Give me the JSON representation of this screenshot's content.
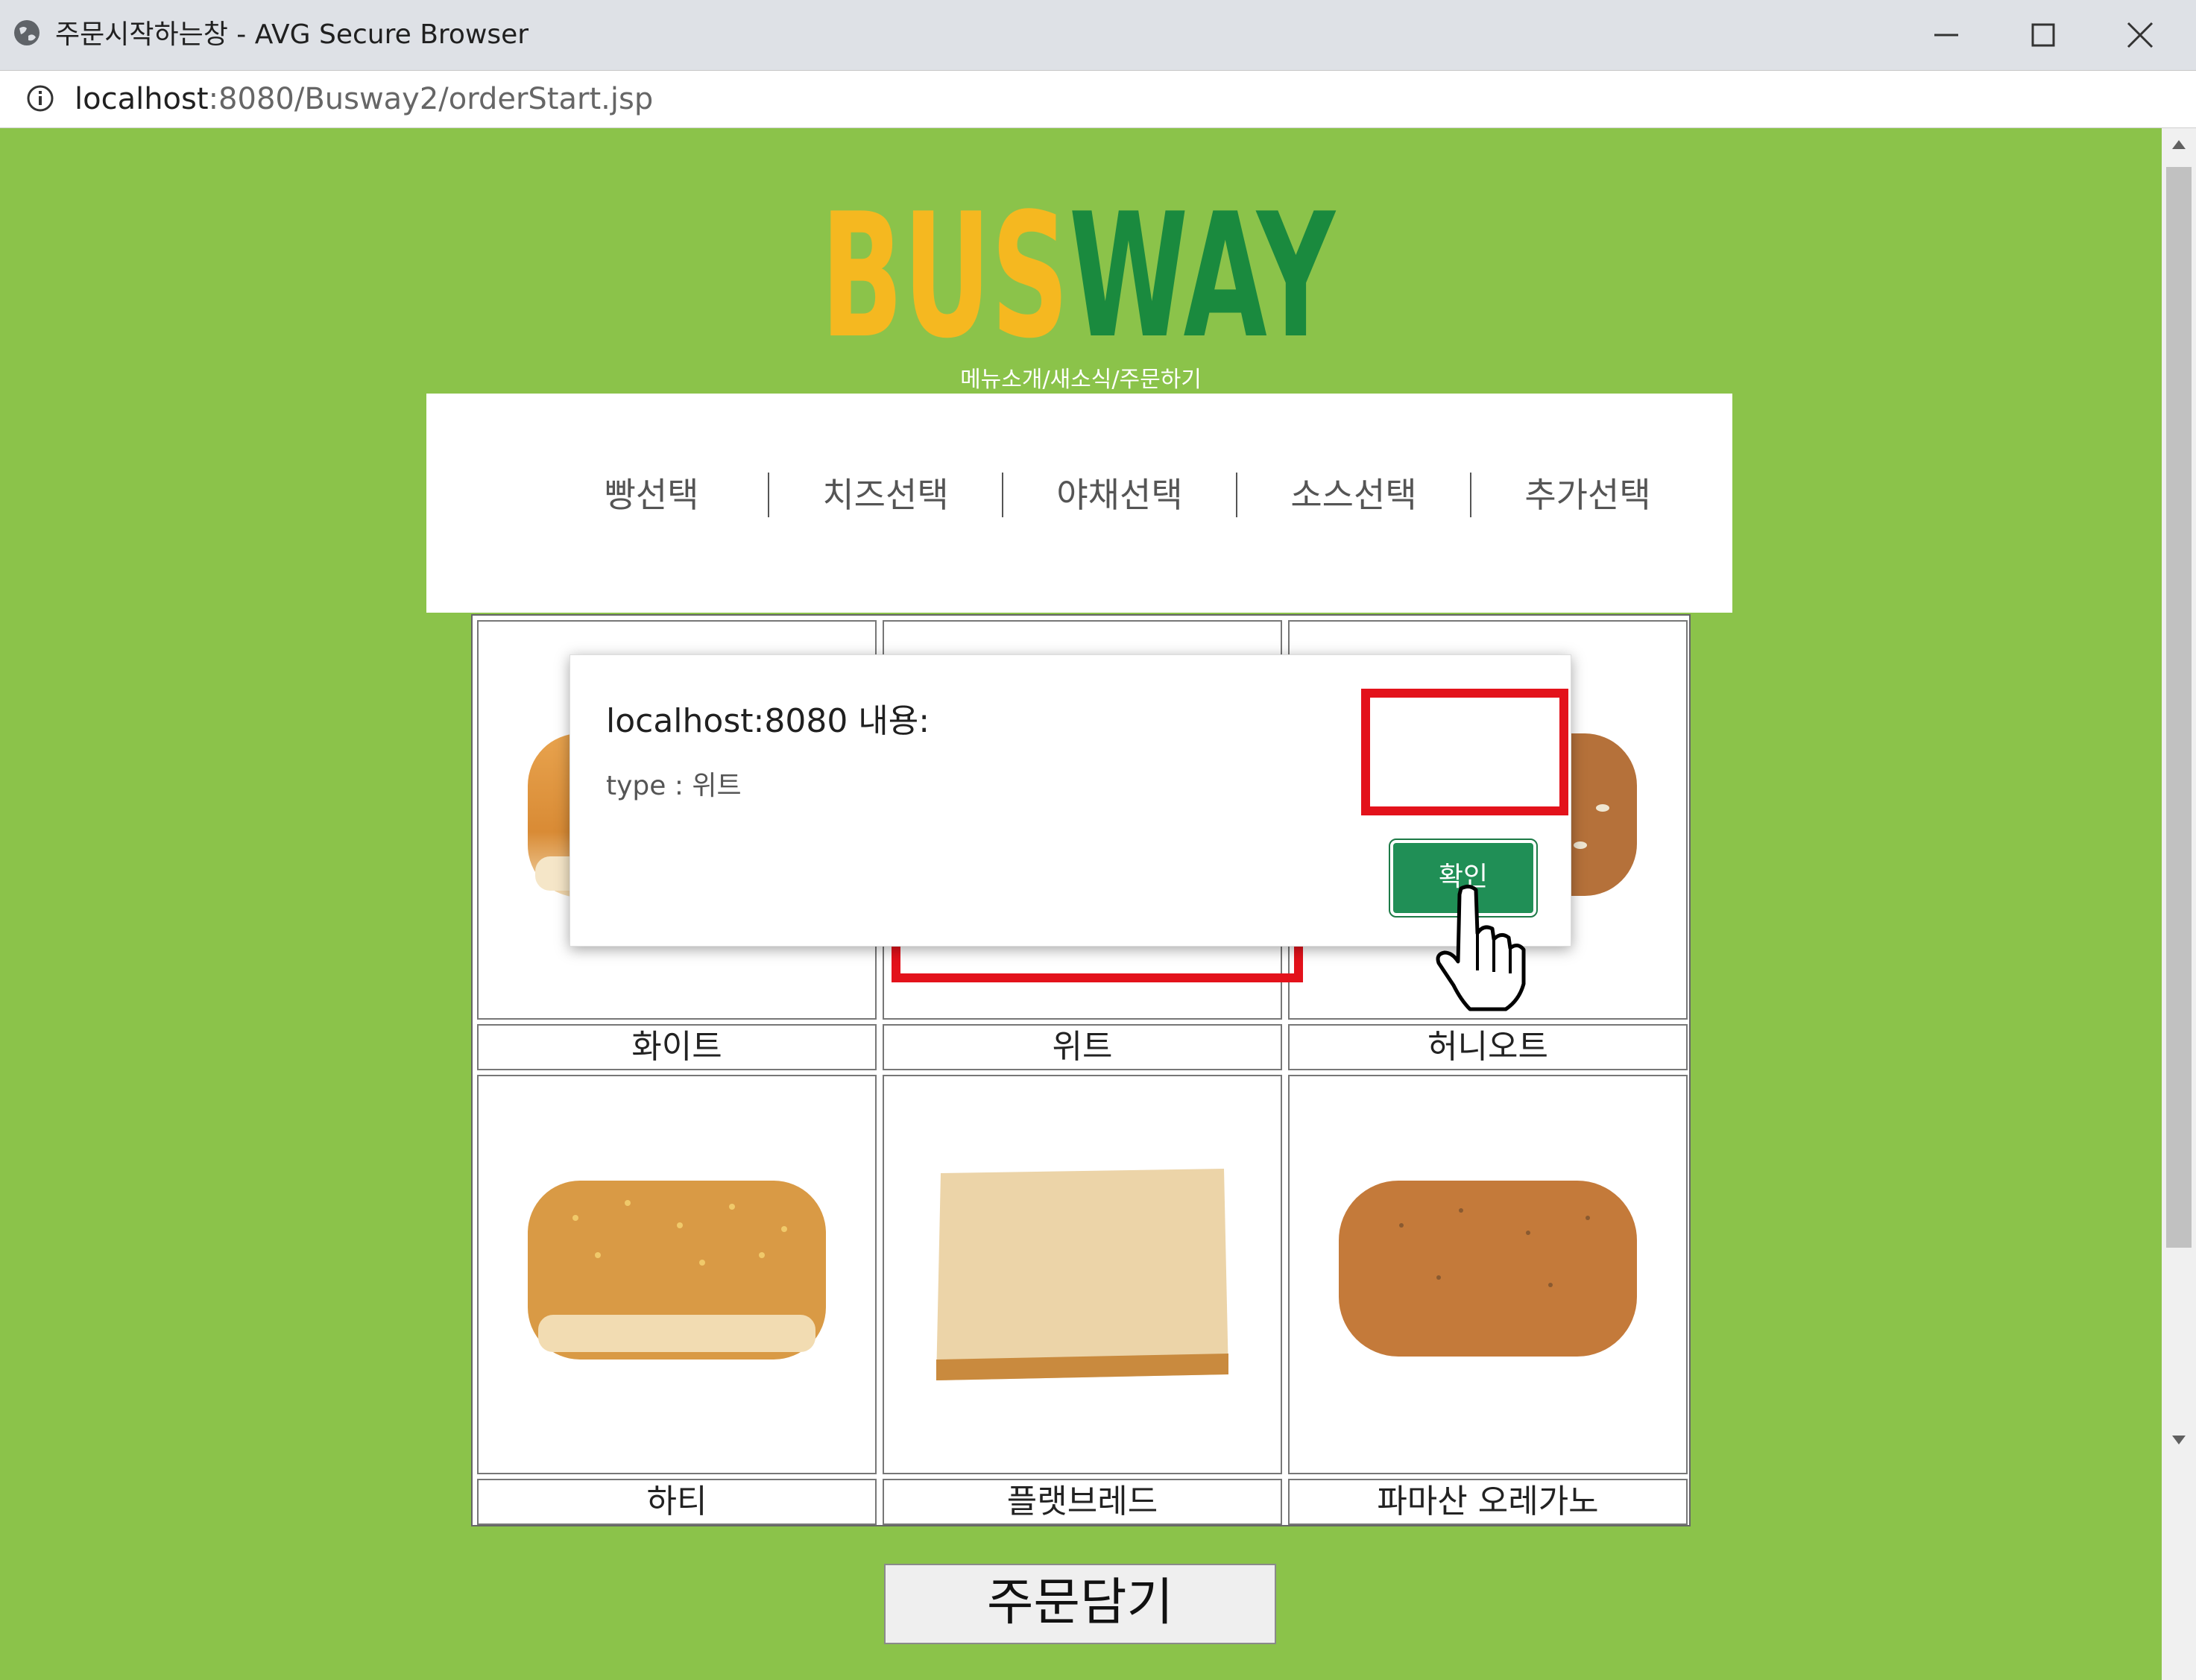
{
  "window": {
    "title": "주문시작하는창 - AVG Secure Browser",
    "url_host": "localhost",
    "url_rest": ":8080/Busway2/orderStart.jsp"
  },
  "logo": {
    "part1": "BUS",
    "part2": "WAY",
    "color1": "#f5b820",
    "color2": "#1a8a3e"
  },
  "subnav": "메뉴소개/새소식/주문하기",
  "tabs": [
    "빵선택",
    "치즈선택",
    "야채선택",
    "소스선택",
    "추가선택"
  ],
  "breads": [
    {
      "name": "화이트",
      "image": "white-bread-image"
    },
    {
      "name": "위트",
      "image": "wheat-bread-image"
    },
    {
      "name": "허니오트",
      "image": "honey-oat-bread-image"
    },
    {
      "name": "하티",
      "image": "hearty-bread-image"
    },
    {
      "name": "플랫브레드",
      "image": "flatbread-image"
    },
    {
      "name": "파마산 오레가노",
      "image": "parmesan-oregano-bread-image"
    }
  ],
  "order_button": "주문담기",
  "dialog": {
    "title": "localhost:8080 내용:",
    "message": "type : 위트",
    "ok_label": "확인"
  },
  "colors": {
    "page_bg": "#8bc34a",
    "highlight": "#e3121b",
    "ok_button": "#208f56"
  }
}
